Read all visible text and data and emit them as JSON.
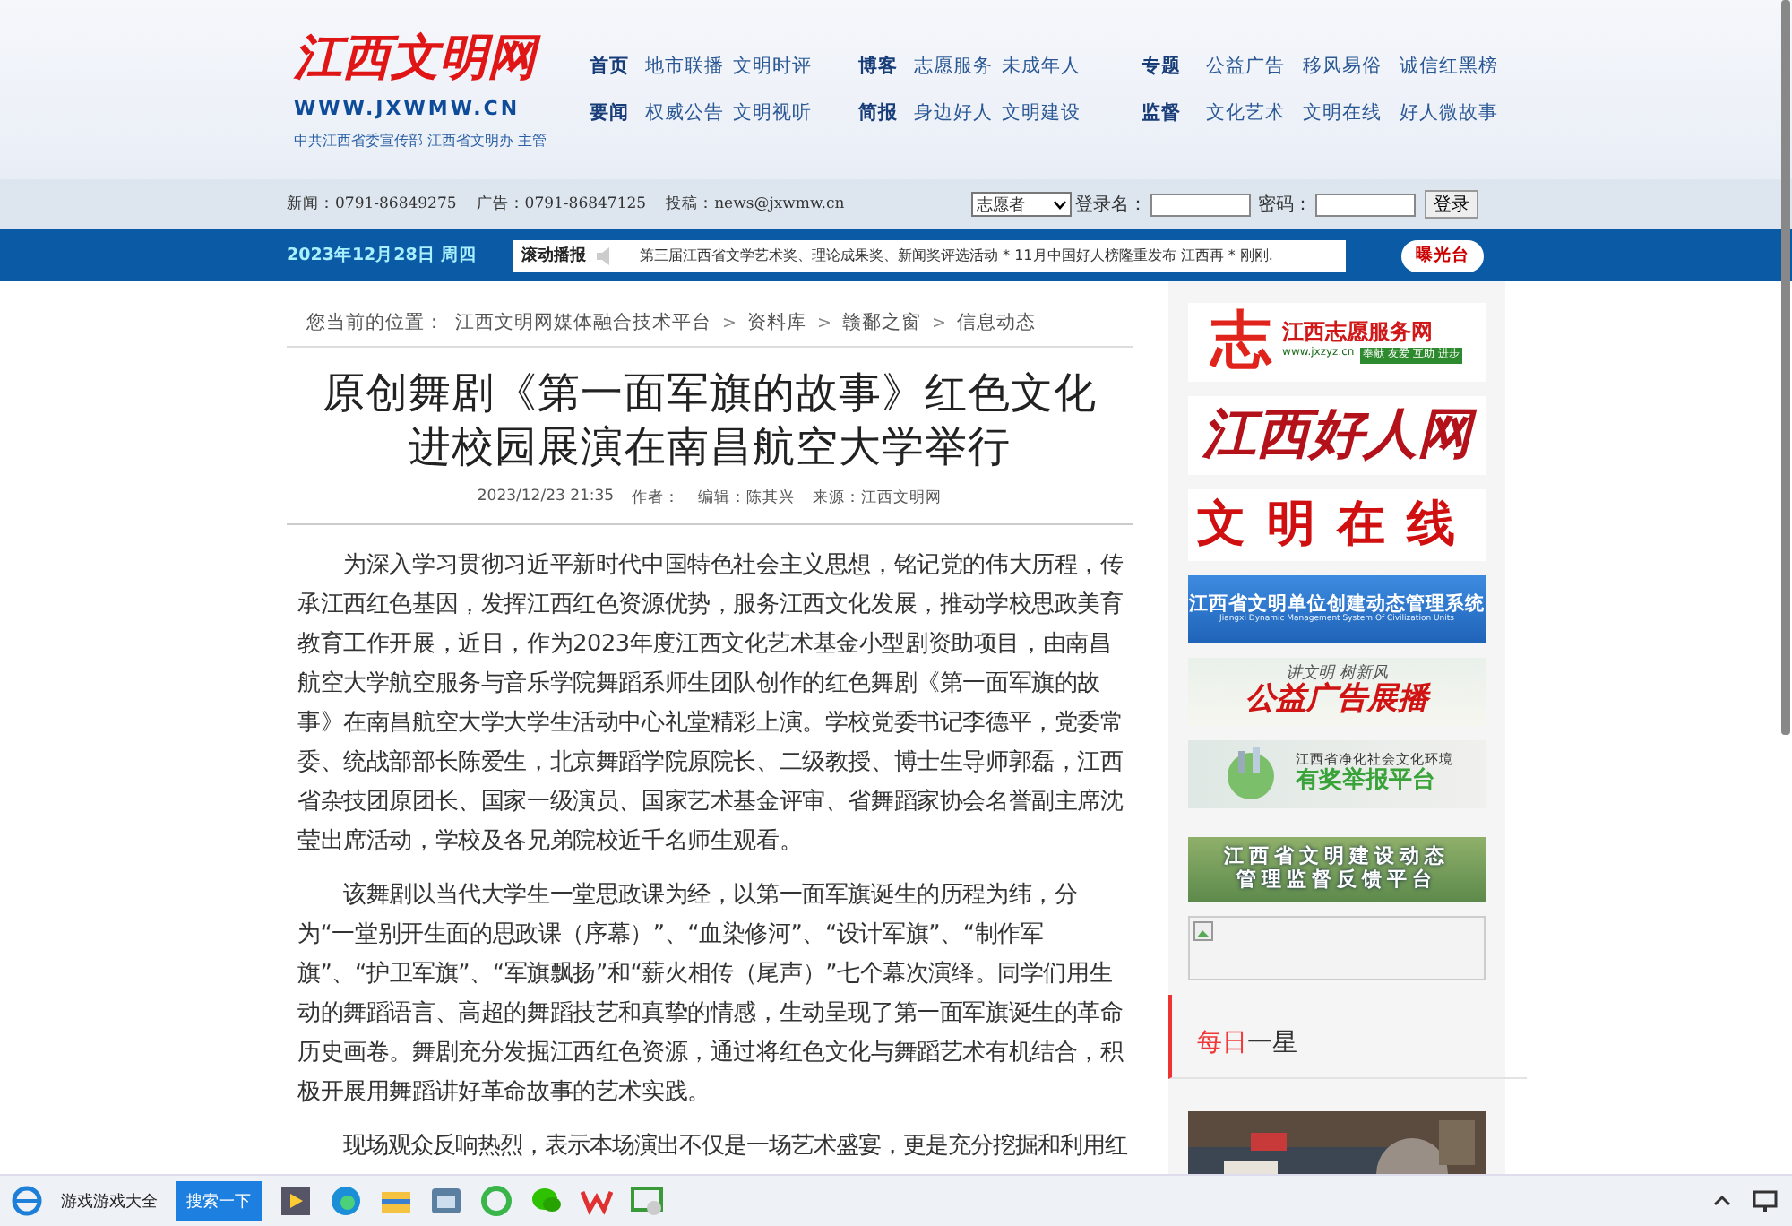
{
  "header": {
    "logo": {
      "title": "江西文明网",
      "url": "WWW.JXWMW.CN",
      "subtitle": "中共江西省委宣传部 江西省文明办 主管"
    },
    "nav_groups": [
      {
        "rows": [
          {
            "heading": "首页",
            "links": [
              "地市联播",
              "文明时评"
            ]
          },
          {
            "heading": "要闻",
            "links": [
              "权威公告",
              "文明视听"
            ]
          }
        ]
      },
      {
        "rows": [
          {
            "heading": "博客",
            "links": [
              "志愿服务",
              "未成年人"
            ]
          },
          {
            "heading": "简报",
            "links": [
              "身边好人",
              "文明建设"
            ]
          }
        ]
      },
      {
        "rows": [
          {
            "heading": "专题",
            "links": [
              "公益广告",
              "移风易俗",
              "诚信红黑榜"
            ]
          },
          {
            "heading": "监督",
            "links": [
              "文化艺术",
              "文明在线",
              "好人微故事"
            ]
          }
        ]
      }
    ]
  },
  "info_bar": {
    "contacts": [
      "新闻：0791-86849275",
      "广告：0791-86847125",
      "投稿：news@jxwmw.cn"
    ],
    "role_select": "志愿者",
    "username_label": "登录名：",
    "password_label": "密码：",
    "login_button": "登录"
  },
  "ticker_bar": {
    "date": "2023年12月28日 周四",
    "ticker_label": "滚动播报",
    "ticker_text": "第三届江西省文学艺术奖、理论成果奖、新闻奖评选活动 * 11月中国好人榜隆重发布 江西再  * 刚刚.",
    "exposure_button": "曝光台"
  },
  "breadcrumb": {
    "label": "您当前的位置：",
    "trail": [
      {
        "kind": "link",
        "text": "江西文明网媒体融合技术平台"
      },
      {
        "kind": "separator",
        "text": ">"
      },
      {
        "kind": "link",
        "text": "资料库"
      },
      {
        "kind": "separator",
        "text": ">"
      },
      {
        "kind": "link",
        "text": "赣鄱之窗"
      },
      {
        "kind": "separator",
        "text": ">"
      },
      {
        "kind": "link",
        "text": "信息动态"
      }
    ]
  },
  "article": {
    "title_lines": [
      "原创舞剧《第一面军旗的故事》红色文化",
      "进校园展演在南昌航空大学举行"
    ],
    "meta": [
      "2023/12/23 21:35",
      "作者：",
      "编辑：陈其兴",
      "来源：江西文明网"
    ],
    "paragraphs": [
      "为深入学习贯彻习近平新时代中国特色社会主义思想，铭记党的伟大历程，传承江西红色基因，发挥江西红色资源优势，服务江西文化发展，推动学校思政美育教育工作开展，近日，作为2023年度江西文化艺术基金小型剧资助项目，由南昌航空大学航空服务与音乐学院舞蹈系师生团队创作的红色舞剧《第一面军旗的故事》在南昌航空大学大学生活动中心礼堂精彩上演。学校党委书记李德平，党委常委、统战部部长陈爱生，北京舞蹈学院原院长、二级教授、博士生导师郭磊，江西省杂技团原团长、国家一级演员、国家艺术基金评审、省舞蹈家协会名誉副主席沈莹出席活动，学校及各兄弟院校近千名师生观看。",
      "该舞剧以当代大学生一堂思政课为经，以第一面军旗诞生的历程为纬，分为“一堂别开生面的思政课（序幕）”、“血染修河”、“设计军旗”、“制作军旗”、“护卫军旗”、“军旗飘扬”和“薪火相传（尾声）”七个幕次演绎。同学们用生动的舞蹈语言、高超的舞蹈技艺和真挚的情感，生动呈现了第一面军旗诞生的革命历史画卷。舞剧充分发掘江西红色资源，通过将红色文化与舞蹈艺术有机结合，积极开展用舞蹈讲好革命故事的艺术实践。",
      "现场观众反响热烈，表示本场演出不仅是一场艺术盛宴，更是充分挖掘和利用红"
    ]
  },
  "sidebar": {
    "banners": [
      {
        "kind": "volunteer",
        "mark": "志",
        "title": "江西志愿服务网",
        "url": "www.jxzyz.cn",
        "slogan": "奉献 友爱 互助 进步"
      },
      {
        "kind": "script",
        "title": "江西好人网"
      },
      {
        "kind": "bold",
        "title": "文明在线"
      },
      {
        "kind": "blue",
        "title": "江西省文明单位创建动态管理系统",
        "subtitle": "Jiangxi Dynamic Management System Of Civilization Units"
      },
      {
        "kind": "ad",
        "subtitle": "讲文明 树新风",
        "title": "公益广告展播"
      },
      {
        "kind": "report",
        "subtitle": "江西省净化社会文化环境",
        "title": "有奖举报平台"
      },
      {
        "kind": "feedback",
        "title": "江西省文明建设动态",
        "subtitle": "管理监督反馈平台"
      },
      {
        "kind": "broken"
      }
    ],
    "daily_star": {
      "accent": "每日",
      "rest": "一星"
    }
  },
  "taskbar": {
    "search_app": "游戏游戏大全",
    "search_button": "搜索一下"
  }
}
